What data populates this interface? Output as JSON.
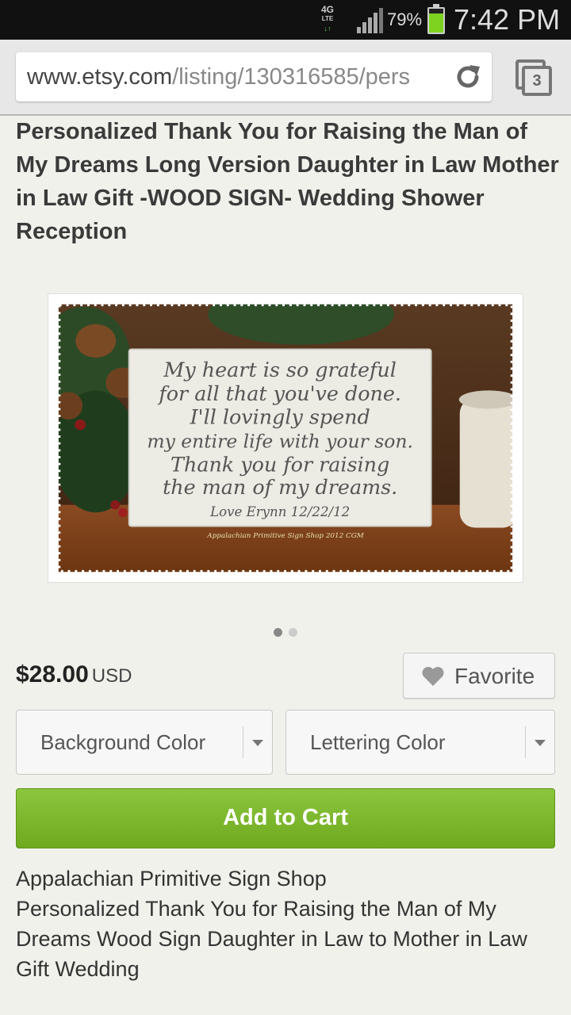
{
  "status_bar": {
    "network": "4G",
    "network_sub": "LTE",
    "battery_pct": "79%",
    "battery_level": 0.79,
    "time": "7:42 PM",
    "battery_color": "#7ed321"
  },
  "browser": {
    "url_domain": "www.etsy.com",
    "url_path": "/listing/130316585/pers",
    "tab_count": "3"
  },
  "listing": {
    "title": "Personalized Thank You for Raising the Man of My Dreams Long Version Daughter in Law Mother in Law Gift -WOOD SIGN- Wedding Shower Reception",
    "sign_lines": [
      "My heart is so grateful",
      "for all that you've done.",
      "I'll lovingly spend",
      "my entire life with your son.",
      "Thank you for raising",
      "the man of my dreams."
    ],
    "sign_signature": "Love  Erynn 12/22/12",
    "sign_credit": "Appalachian Primitive Sign Shop 2012 CGM",
    "image_dots": 2,
    "price": "$28.00",
    "currency": "USD",
    "favorite_label": "Favorite",
    "background_select": "Background Color",
    "lettering_select": "Lettering Color",
    "add_to_cart": "Add to Cart",
    "shop_name": "Appalachian Primitive Sign Shop",
    "description": "Personalized Thank You for Raising the Man of My Dreams Wood Sign Daughter in Law to Mother in Law Gift Wedding",
    "accent_color": "#7ab82d"
  }
}
